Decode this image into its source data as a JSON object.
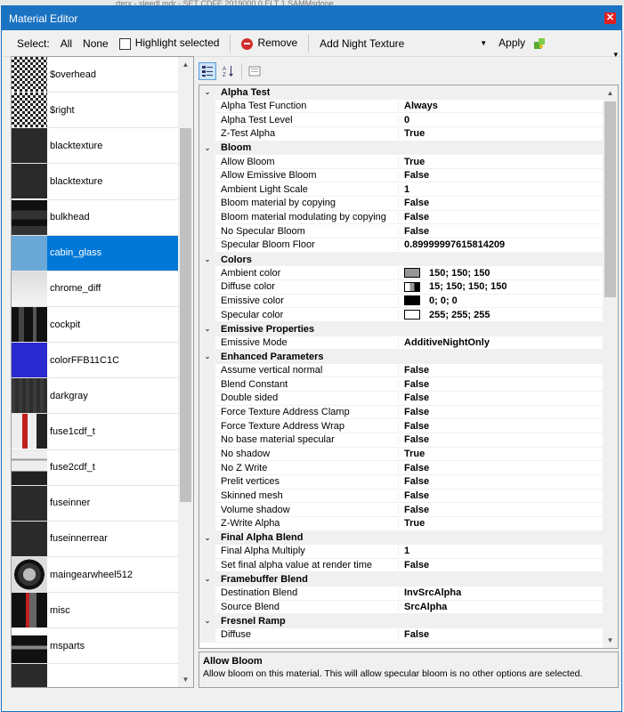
{
  "bg": {
    "text": "rterx - sleedl.mdr - SET CDFE 2019000 0 ELT 1 SAMMsdone"
  },
  "window": {
    "title": "Material Editor",
    "close": "✕"
  },
  "toolbar": {
    "select_label": "Select:",
    "all_label": "All",
    "none_label": "None",
    "highlight_label": "Highlight selected",
    "remove_label": "Remove",
    "night_texture_value": "Add Night Texture",
    "apply_label": "Apply"
  },
  "textures": [
    {
      "label": "$overhead",
      "thumb": "checker"
    },
    {
      "label": "$right",
      "thumb": "checker"
    },
    {
      "label": "blacktexture",
      "thumb": "dark"
    },
    {
      "label": "blacktexture",
      "thumb": "dark"
    },
    {
      "label": "bulkhead",
      "thumb": "bulk"
    },
    {
      "label": "cabin_glass",
      "thumb": "glass"
    },
    {
      "label": "chrome_diff",
      "thumb": "chrome"
    },
    {
      "label": "cockpit",
      "thumb": "cockpit"
    },
    {
      "label": "colorFFB11C1C",
      "thumb": "blue"
    },
    {
      "label": "darkgray",
      "thumb": "darkgray"
    },
    {
      "label": "fuse1cdf_t",
      "thumb": "fuse1"
    },
    {
      "label": "fuse2cdf_t",
      "thumb": "fuse2"
    },
    {
      "label": "fuseinner",
      "thumb": "dark"
    },
    {
      "label": "fuseinnerrear",
      "thumb": "dark"
    },
    {
      "label": "maingearwheel512",
      "thumb": "wheel"
    },
    {
      "label": "misc",
      "thumb": "misc"
    },
    {
      "label": "msparts",
      "thumb": "msparts"
    },
    {
      "label": "",
      "thumb": "dark"
    }
  ],
  "selected_texture_index": 5,
  "categories": [
    {
      "name": "Alpha Test",
      "props": [
        {
          "name": "Alpha Test Function",
          "value": "Always"
        },
        {
          "name": "Alpha Test Level",
          "value": "0"
        },
        {
          "name": "Z-Test Alpha",
          "value": "True"
        }
      ]
    },
    {
      "name": "Bloom",
      "props": [
        {
          "name": "Allow Bloom",
          "value": "True"
        },
        {
          "name": "Allow Emissive Bloom",
          "value": "False"
        },
        {
          "name": "Ambient Light Scale",
          "value": "1"
        },
        {
          "name": "Bloom material by copying",
          "value": "False"
        },
        {
          "name": "Bloom material modulating by copying",
          "value": "False"
        },
        {
          "name": "No Specular Bloom",
          "value": "False"
        },
        {
          "name": "Specular Bloom Floor",
          "value": "0.89999997615814209"
        }
      ]
    },
    {
      "name": "Colors",
      "props": [
        {
          "name": "Ambient color",
          "value": "150; 150; 150",
          "swatch": "#969696"
        },
        {
          "name": "Diffuse color",
          "value": "15; 150; 150; 150",
          "swatch": "split"
        },
        {
          "name": "Emissive color",
          "value": "0; 0; 0",
          "swatch": "#000000"
        },
        {
          "name": "Specular color",
          "value": "255; 255; 255",
          "swatch": "#ffffff"
        }
      ]
    },
    {
      "name": "Emissive Properties",
      "props": [
        {
          "name": "Emissive Mode",
          "value": "AdditiveNightOnly"
        }
      ]
    },
    {
      "name": "Enhanced Parameters",
      "props": [
        {
          "name": "Assume vertical normal",
          "value": "False"
        },
        {
          "name": "Blend Constant",
          "value": "False"
        },
        {
          "name": "Double sided",
          "value": "False"
        },
        {
          "name": "Force Texture Address Clamp",
          "value": "False"
        },
        {
          "name": "Force Texture Address Wrap",
          "value": "False"
        },
        {
          "name": "No base material specular",
          "value": "False"
        },
        {
          "name": "No shadow",
          "value": "True"
        },
        {
          "name": "No Z Write",
          "value": "False"
        },
        {
          "name": "Prelit vertices",
          "value": "False"
        },
        {
          "name": "Skinned mesh",
          "value": "False"
        },
        {
          "name": "Volume shadow",
          "value": "False"
        },
        {
          "name": "Z-Write Alpha",
          "value": "True"
        }
      ]
    },
    {
      "name": "Final Alpha Blend",
      "props": [
        {
          "name": "Final Alpha Multiply",
          "value": "1"
        },
        {
          "name": "Set final alpha value at render time",
          "value": "False"
        }
      ]
    },
    {
      "name": "Framebuffer Blend",
      "props": [
        {
          "name": "Destination Blend",
          "value": "InvSrcAlpha"
        },
        {
          "name": "Source Blend",
          "value": "SrcAlpha"
        }
      ]
    },
    {
      "name": "Fresnel Ramp",
      "props": [
        {
          "name": "Diffuse",
          "value": "False"
        }
      ]
    }
  ],
  "description": {
    "title": "Allow Bloom",
    "text": "Allow bloom on this material. This will allow specular bloom is no other options are selected."
  },
  "colors": {
    "accent": "#1a73c2",
    "selection": "#0078d7"
  }
}
